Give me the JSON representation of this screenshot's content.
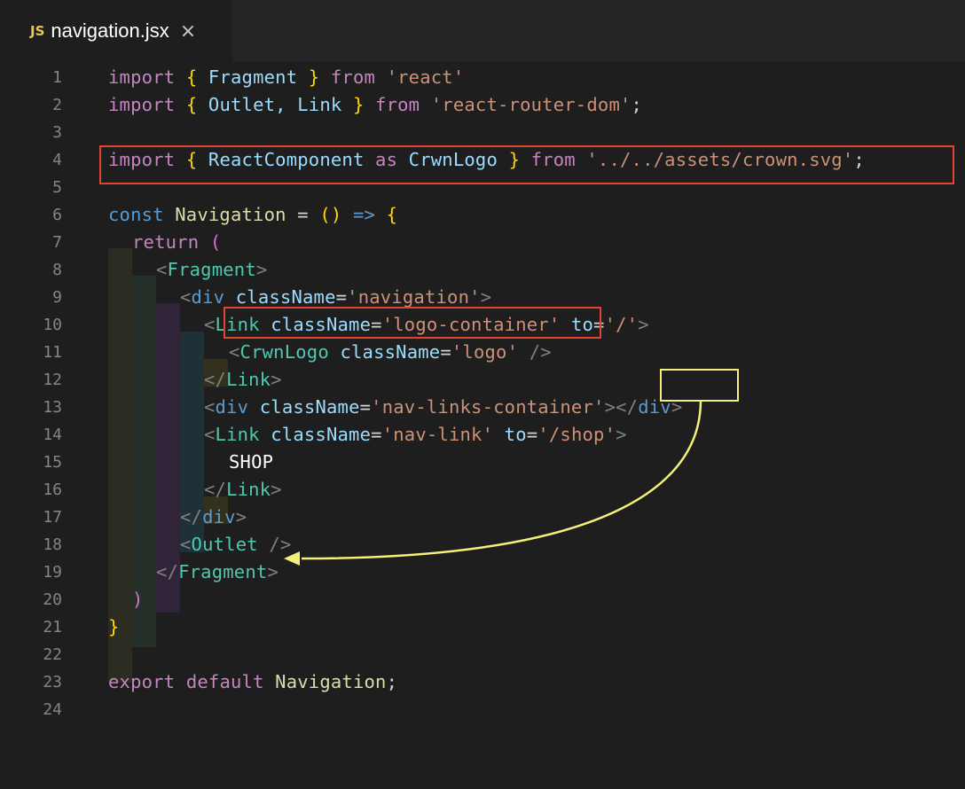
{
  "tab": {
    "lang_badge": "JS",
    "filename": "navigation.jsx",
    "close_glyph": "×"
  },
  "line_numbers": [
    "1",
    "2",
    "3",
    "4",
    "5",
    "6",
    "7",
    "8",
    "9",
    "10",
    "11",
    "12",
    "13",
    "14",
    "15",
    "16",
    "17",
    "18",
    "19",
    "20",
    "21",
    "22",
    "23",
    "24"
  ],
  "code": {
    "l1": [
      "import",
      " ",
      "{",
      " Fragment ",
      "}",
      " ",
      "from",
      " ",
      "'react'"
    ],
    "l2": [
      "import",
      " ",
      "{",
      " Outlet, Link ",
      "}",
      " ",
      "from",
      " ",
      "'react-router-dom'",
      ";"
    ],
    "l4": [
      "import",
      " ",
      "{",
      " ReactComponent ",
      "as",
      " CrwnLogo ",
      "}",
      " ",
      "from",
      " ",
      "'../../assets/crown.svg'",
      ";"
    ],
    "l6": [
      "const",
      " ",
      "Navigation",
      " = ",
      "()",
      " ",
      "=>",
      " ",
      "{"
    ],
    "l7": [
      "return",
      " ",
      "("
    ],
    "l8": [
      "<",
      "Fragment",
      ">"
    ],
    "l9": [
      "<",
      "div",
      " ",
      "className",
      "=",
      "'navigation'",
      ">"
    ],
    "l10": [
      "<",
      "Link",
      " ",
      "className",
      "=",
      "'logo-container'",
      " ",
      "to",
      "=",
      "'/'",
      ">"
    ],
    "l11": [
      "<",
      "CrwnLogo",
      " ",
      "className",
      "=",
      "'logo'",
      " ",
      "/>"
    ],
    "l12": [
      "</",
      "Link",
      ">"
    ],
    "l13": [
      "<",
      "div",
      " ",
      "className",
      "=",
      "'nav-links-container'",
      ">",
      "</",
      "div",
      ">"
    ],
    "l14": [
      "<",
      "Link",
      " ",
      "className",
      "=",
      "'nav-link'",
      " ",
      "to",
      "=",
      "'/shop'",
      ">"
    ],
    "l15": [
      "SHOP"
    ],
    "l16": [
      "</",
      "Link",
      ">"
    ],
    "l17": [
      "</",
      "div",
      ">"
    ],
    "l18": [
      "<",
      "Outlet",
      " ",
      "/>"
    ],
    "l19": [
      "</",
      "Fragment",
      ">"
    ],
    "l20": [
      ")"
    ],
    "l21": [
      "}"
    ],
    "l23": [
      "export",
      " ",
      "default",
      " ",
      "Navigation",
      ";"
    ]
  },
  "colors": {
    "background": "#1e1e1e",
    "keyword": "#c586c0",
    "keyword_blue": "#569cd6",
    "string": "#ce9178",
    "tag": "#4ec9b0",
    "red_highlight": "#e2442f",
    "yellow_highlight": "#f4f07a"
  }
}
